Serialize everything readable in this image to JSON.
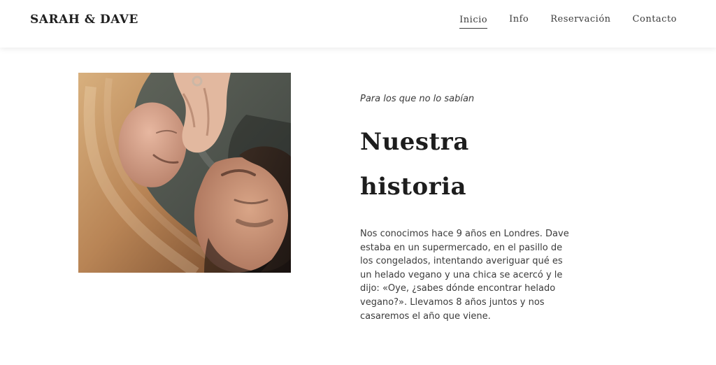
{
  "header": {
    "brand": "SARAH & DAVE",
    "nav": [
      {
        "label": "Inicio",
        "active": true
      },
      {
        "label": "Info",
        "active": false
      },
      {
        "label": "Reservación",
        "active": false
      },
      {
        "label": "Contacto",
        "active": false
      }
    ]
  },
  "hero": {
    "image_alt": "couple-photo",
    "kicker": "Para los que no lo sabían",
    "title": "Nuestra historia",
    "body": "Nos conocimos hace 9 años en Londres. Dave estaba en un supermercado, en el pasillo de los congelados, intentando averiguar qué es un helado vegano y una chica se acercó y le dijo: «Oye, ¿sabes dónde encontrar helado vegano?». Llevamos 8 años juntos y nos casaremos el año que viene."
  }
}
